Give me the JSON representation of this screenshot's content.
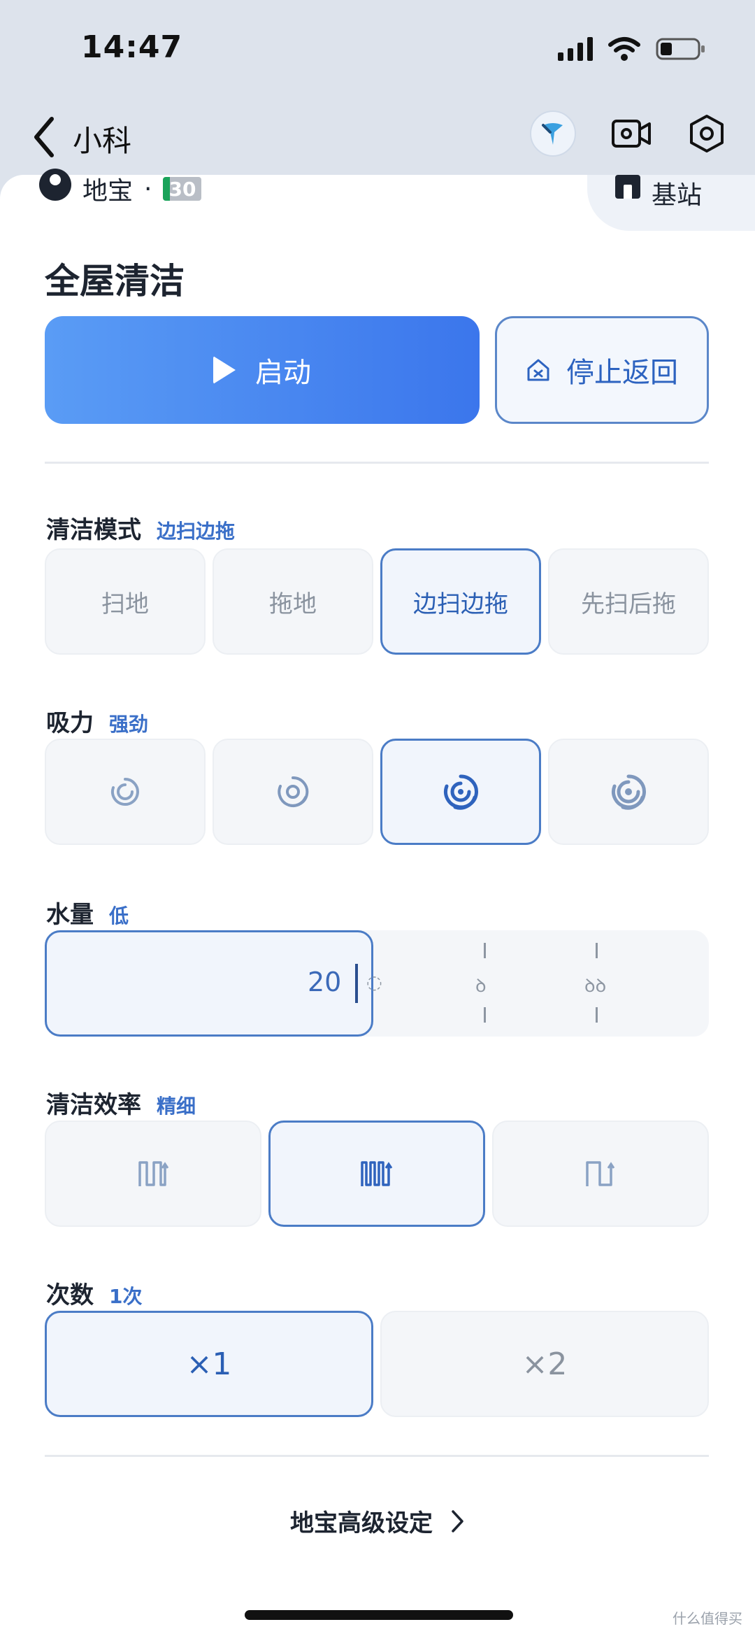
{
  "status": {
    "time": "14:47"
  },
  "nav": {
    "title": "小科"
  },
  "info": {
    "device": "地宝",
    "separator": "·",
    "battery": "30",
    "base": "基站"
  },
  "page": {
    "title": "全屋清洁"
  },
  "actions": {
    "start": "启动",
    "stop": "停止返回"
  },
  "mode": {
    "label": "清洁模式",
    "selected": "边扫边拖",
    "options": [
      "扫地",
      "拖地",
      "边扫边拖",
      "先扫后拖"
    ]
  },
  "suction": {
    "label": "吸力",
    "selected": "强劲",
    "selected_index": 2
  },
  "water": {
    "label": "水量",
    "selected": "低",
    "value": "20"
  },
  "efficiency": {
    "label": "清洁效率",
    "selected": "精细",
    "selected_index": 1
  },
  "count": {
    "label": "次数",
    "selected": "1次",
    "options": [
      "×1",
      "×2"
    ]
  },
  "advanced": {
    "label": "地宝高级设定"
  },
  "watermark": "什么值得买",
  "colors": {
    "accent": "#3b76ec",
    "selected_border": "#4b7cc6",
    "selected_text": "#2b5fb4"
  }
}
